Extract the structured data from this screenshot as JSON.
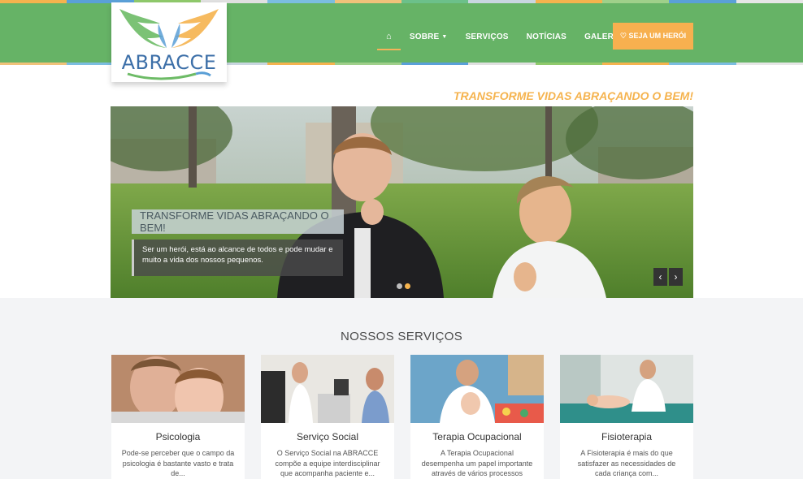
{
  "brand": {
    "name": "ABRACCE"
  },
  "colors": {
    "header_green": "#66b366",
    "accent_orange": "#f5b34e",
    "logo_blue": "#3c6fa8"
  },
  "nav": {
    "items": [
      {
        "label": "⌂",
        "icon": "home-icon"
      },
      {
        "label": "SOBRE",
        "has_dropdown": true
      },
      {
        "label": "SERVIÇOS"
      },
      {
        "label": "NOTÍCIAS"
      },
      {
        "label": "GALERIA",
        "has_dropdown": true
      }
    ],
    "cta_label": "♡ SEJA UM HERÓI"
  },
  "tagline": "TRANSFORME VIDAS ABRAÇANDO O BEM!",
  "hero": {
    "caption_title": "TRANSFORME VIDAS ABRAÇANDO O BEM!",
    "caption_text": "Ser um herói, está ao alcance de todos e pode mudar e muito a vida dos nossos pequenos.",
    "prev": "‹",
    "next": "›"
  },
  "services": {
    "title": "NOSSOS SERVIÇOS",
    "items": [
      {
        "name": "Psicologia",
        "text": "Pode-se perceber que o campo da psicologia é bastante vasto e trata de..."
      },
      {
        "name": "Serviço Social",
        "text": "O Serviço Social na ABRACCE compõe a equipe interdisciplinar que acompanha paciente e..."
      },
      {
        "name": "Terapia Ocupacional",
        "text": "A Terapia Ocupacional desempenha um papel importante através de vários processos incluindo uma..."
      },
      {
        "name": "Fisioterapia",
        "text": "A Fisioterapia é mais do que satisfazer as necessidades de cada criança com..."
      }
    ]
  }
}
